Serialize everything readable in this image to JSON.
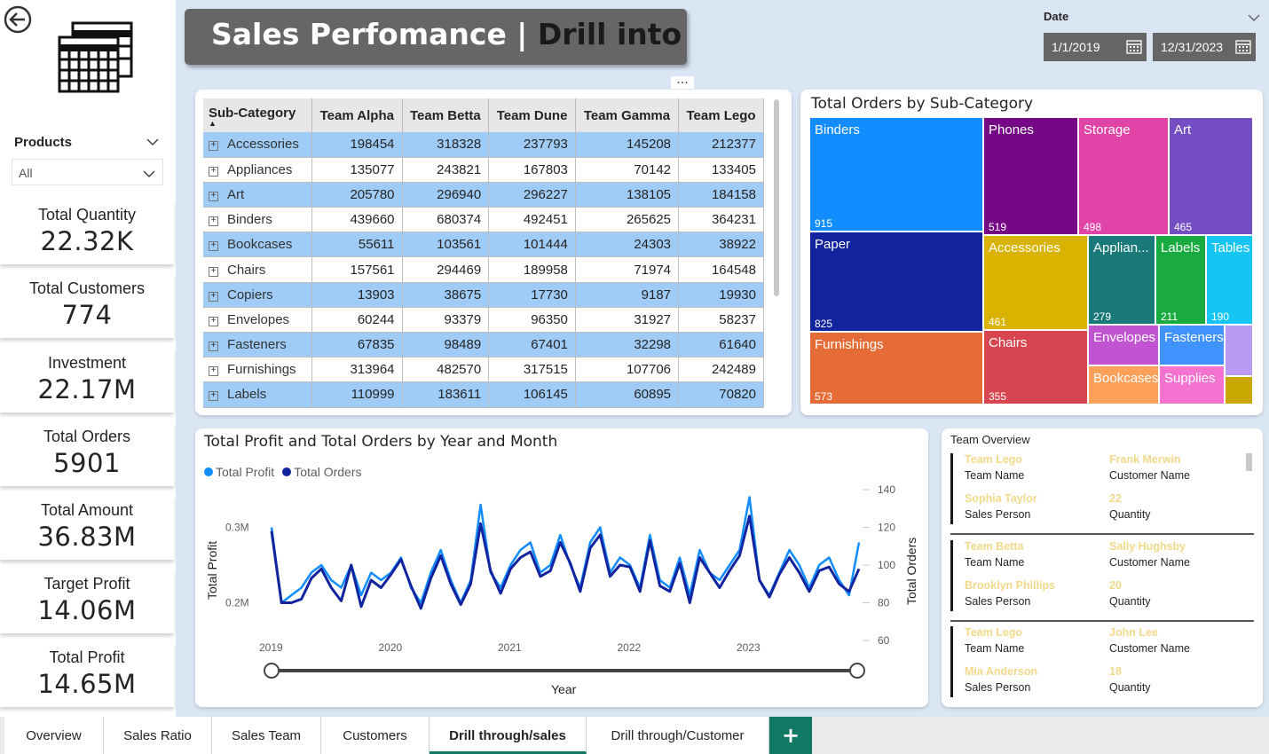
{
  "title": {
    "main": "Sales Perfomance | ",
    "drill": "Drill into"
  },
  "products": {
    "label": "Products",
    "selected": "All"
  },
  "date": {
    "label": "Date",
    "start": "1/1/2019",
    "end": "12/31/2023"
  },
  "kpis": [
    {
      "label": "Total Quantity",
      "value": "22.32K"
    },
    {
      "label": "Total Customers",
      "value": "774"
    },
    {
      "label": "Investment",
      "value": "22.17M"
    },
    {
      "label": "Total Orders",
      "value": "5901"
    },
    {
      "label": "Total Amount",
      "value": "36.83M"
    },
    {
      "label": "Target Profit",
      "value": "14.06M"
    },
    {
      "label": "Total Profit",
      "value": "14.65M"
    }
  ],
  "matrix": {
    "headers": [
      "Sub-Category",
      "Team Alpha",
      "Team Betta",
      "Team Dune",
      "Team Gamma",
      "Team Lego"
    ],
    "rows": [
      [
        "Accessories",
        "198454",
        "318328",
        "237793",
        "145208",
        "212377"
      ],
      [
        "Appliances",
        "135077",
        "243821",
        "167803",
        "70142",
        "133405"
      ],
      [
        "Art",
        "205780",
        "296940",
        "296227",
        "138105",
        "184158"
      ],
      [
        "Binders",
        "439660",
        "680374",
        "492451",
        "265625",
        "364231"
      ],
      [
        "Bookcases",
        "55611",
        "103561",
        "101444",
        "24303",
        "38922"
      ],
      [
        "Chairs",
        "157561",
        "294469",
        "189958",
        "71974",
        "164548"
      ],
      [
        "Copiers",
        "13903",
        "38675",
        "17730",
        "9187",
        "19930"
      ],
      [
        "Envelopes",
        "60244",
        "93379",
        "96350",
        "31927",
        "58237"
      ],
      [
        "Fasteners",
        "67835",
        "98489",
        "67401",
        "32298",
        "61640"
      ],
      [
        "Furnishings",
        "313964",
        "482570",
        "317515",
        "107706",
        "242489"
      ],
      [
        "Labels",
        "110999",
        "183611",
        "106145",
        "60895",
        "70820"
      ]
    ]
  },
  "treemap": {
    "title": "Total Orders by Sub-Category",
    "tiles": [
      {
        "name": "Binders",
        "value": "915",
        "color": "#118dff"
      },
      {
        "name": "Phones",
        "value": "519",
        "color": "#750985"
      },
      {
        "name": "Storage",
        "value": "498",
        "color": "#e044a7"
      },
      {
        "name": "Art",
        "value": "465",
        "color": "#744ec2"
      },
      {
        "name": "Paper",
        "value": "825",
        "color": "#12239e"
      },
      {
        "name": "Accessories",
        "value": "461",
        "color": "#d9b300"
      },
      {
        "name": "Applian...",
        "value": "279",
        "color": "#1a7a7a"
      },
      {
        "name": "Labels",
        "value": "211",
        "color": "#1aab40"
      },
      {
        "name": "Tables",
        "value": "190",
        "color": "#15c6f4"
      },
      {
        "name": "Furnishings",
        "value": "573",
        "color": "#e66c37"
      },
      {
        "name": "Chairs",
        "value": "355",
        "color": "#d64550"
      },
      {
        "name": "Envelopes",
        "value": "",
        "color": "#c155d1"
      },
      {
        "name": "Fasteners",
        "value": "",
        "color": "#4092ff"
      },
      {
        "name": "",
        "value": "",
        "color": "#b99af5"
      },
      {
        "name": "Bookcases",
        "value": "",
        "color": "#ffa058"
      },
      {
        "name": "Supplies",
        "value": "",
        "color": "#f472d0"
      },
      {
        "name": "",
        "value": "",
        "color": "#c7a700"
      }
    ]
  },
  "chart_data": {
    "type": "line",
    "title": "Total Profit and Total Orders by Year and Month",
    "xlabel": "Year",
    "ylabel": "Total Profit",
    "y2label": "Total Orders",
    "x_ticks": [
      "2019",
      "2020",
      "2021",
      "2022",
      "2023"
    ],
    "y_ticks": [
      "0.2M",
      "0.3M"
    ],
    "y2_ticks": [
      "60",
      "80",
      "100",
      "120",
      "140"
    ],
    "ylim": [
      0.15,
      0.35
    ],
    "y2lim": [
      60,
      140
    ],
    "legend_position": "top-left",
    "series": [
      {
        "name": "Total Profit",
        "color": "#118dff",
        "axis": "left",
        "values": [
          0.3,
          0.2,
          0.21,
          0.22,
          0.24,
          0.25,
          0.23,
          0.22,
          0.25,
          0.21,
          0.24,
          0.23,
          0.24,
          0.26,
          0.22,
          0.2,
          0.24,
          0.27,
          0.23,
          0.2,
          0.23,
          0.33,
          0.24,
          0.22,
          0.25,
          0.27,
          0.28,
          0.24,
          0.25,
          0.29,
          0.25,
          0.22,
          0.28,
          0.3,
          0.24,
          0.26,
          0.25,
          0.22,
          0.29,
          0.23,
          0.22,
          0.26,
          0.21,
          0.27,
          0.24,
          0.23,
          0.25,
          0.27,
          0.34,
          0.23,
          0.21,
          0.24,
          0.27,
          0.25,
          0.22,
          0.25,
          0.26,
          0.23,
          0.21,
          0.28
        ]
      },
      {
        "name": "Total Orders",
        "color": "#12239e",
        "axis": "right",
        "values": [
          118,
          80,
          80,
          82,
          93,
          98,
          88,
          81,
          100,
          78,
          92,
          88,
          95,
          103,
          89,
          77,
          93,
          105,
          90,
          79,
          90,
          122,
          97,
          85,
          98,
          104,
          107,
          94,
          97,
          112,
          101,
          86,
          109,
          116,
          94,
          100,
          99,
          86,
          113,
          89,
          86,
          101,
          80,
          104,
          96,
          88,
          97,
          105,
          126,
          92,
          83,
          95,
          104,
          96,
          86,
          97,
          99,
          90,
          86,
          98
        ]
      }
    ]
  },
  "team_overview": {
    "title": "Team Overview",
    "records": [
      {
        "team": "Team Lego",
        "team_label": "Team Name",
        "customer": "Frank Merwin",
        "customer_label": "Customer Name",
        "person": "Sophia Taylor",
        "person_label": "Sales Person",
        "qty": "22",
        "qty_label": "Quantity"
      },
      {
        "team": "Team Betta",
        "team_label": "Team Name",
        "customer": "Sally Hughsby",
        "customer_label": "Customer Name",
        "person": "Brooklyn Phillips",
        "person_label": "Sales Person",
        "qty": "20",
        "qty_label": "Quantity"
      },
      {
        "team": "Team Lego",
        "team_label": "Team Name",
        "customer": "John Lee",
        "customer_label": "Customer Name",
        "person": "Mia Anderson",
        "person_label": "Sales Person",
        "qty": "18",
        "qty_label": "Quantity"
      }
    ]
  },
  "tabs": [
    "Overview",
    "Sales Ratio",
    "Sales Team",
    "Customers",
    "Drill through/sales",
    "Drill through/Customer"
  ],
  "add_tab": "+",
  "more_dots": "..."
}
